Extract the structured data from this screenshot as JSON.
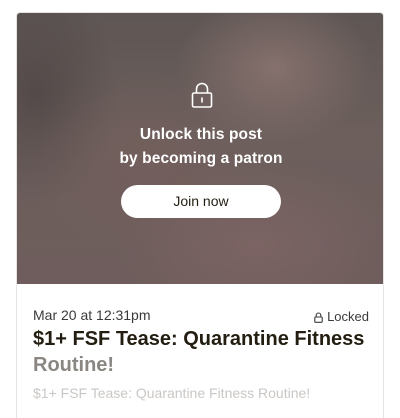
{
  "locked_media": {
    "icon": "lock-icon",
    "unlock_line1": "Unlock this post",
    "unlock_line2": "by becoming a patron",
    "join_label": "Join now"
  },
  "post": {
    "date": "Mar 20 at 12:31pm",
    "status_icon": "lock-icon",
    "status": "Locked",
    "title_line1": "$1+ FSF Tease: Quarantine Fitness",
    "title_line2": "Routine!",
    "excerpt": "$1+ FSF Tease: Quarantine Fitness Routine!"
  },
  "colors": {
    "title_text": "#241e12",
    "join_button_bg": "#ffffff",
    "overlay_text": "#ffffff"
  }
}
